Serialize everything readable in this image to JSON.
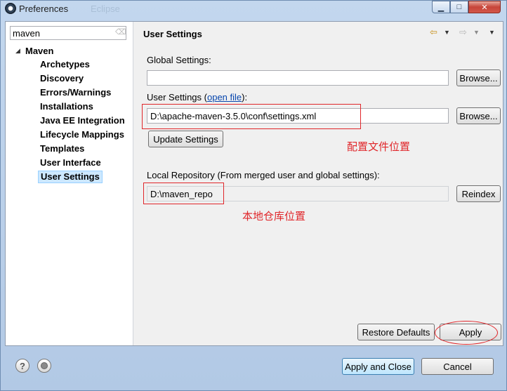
{
  "window": {
    "title": "Preferences",
    "background_title": "Eclipse"
  },
  "filter": {
    "value": "maven"
  },
  "tree": {
    "root": "Maven",
    "items": [
      "Archetypes",
      "Discovery",
      "Errors/Warnings",
      "Installations",
      "Java EE Integration",
      "Lifecycle Mappings",
      "Templates",
      "User Interface",
      "User Settings"
    ],
    "selected": "User Settings"
  },
  "page": {
    "title": "User Settings",
    "global_settings_label": "Global Settings:",
    "global_settings_value": "",
    "user_settings_label_prefix": "User Settings (",
    "open_file_link": "open file",
    "user_settings_label_suffix": "):",
    "user_settings_value": "D:\\apache-maven-3.5.0\\conf\\settings.xml",
    "local_repo_label": "Local Repository (From merged user and global settings):",
    "local_repo_value": "D:\\maven_repo",
    "browse_label": "Browse...",
    "update_settings_label": "Update Settings",
    "reindex_label": "Reindex",
    "restore_defaults_label": "Restore Defaults",
    "apply_label": "Apply"
  },
  "annotations": {
    "config_note": "配置文件位置",
    "repo_note": "本地仓库位置",
    "color": "#e0262a"
  },
  "footer": {
    "help_icon": "question-icon",
    "record_icon": "record-icon",
    "apply_close_label": "Apply and Close",
    "cancel_label": "Cancel"
  }
}
